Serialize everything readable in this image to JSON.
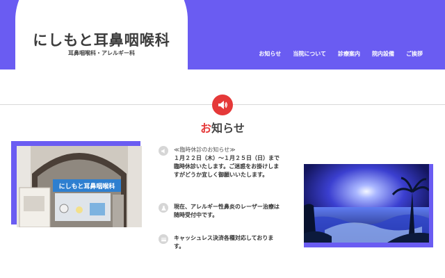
{
  "site": {
    "title": "にしもと耳鼻咽喉科",
    "subtitle": "耳鼻咽喉科・アレルギー科"
  },
  "nav": {
    "items": [
      {
        "label": "お知らせ"
      },
      {
        "label": "当院について"
      },
      {
        "label": "診療案内"
      },
      {
        "label": "院内設備"
      },
      {
        "label": "ご挨拶"
      }
    ]
  },
  "section": {
    "title_accent": "お",
    "title_rest": "知らせ",
    "icon": "megaphone-icon"
  },
  "news": [
    {
      "icon": "megaphone-icon",
      "heading": "≪臨時休診のお知らせ≫",
      "body": "１月２２日（木）～１月２５日（日）まで臨時休診いたします。ご迷惑をお掛けしますがどうか宜しく御願いいたします。"
    },
    {
      "icon": "flask-icon",
      "heading": "",
      "body": "現在、アレルギー性鼻炎のレーザー治療は随時受付中です。"
    },
    {
      "icon": "card-icon",
      "heading": "",
      "body": "キャッシュレス決済各種対応しております。"
    }
  ],
  "photo_left": {
    "sign_text": "にしもと耳鼻咽喉科"
  },
  "colors": {
    "brand": "#6a5cf2",
    "accent": "#e53939"
  }
}
